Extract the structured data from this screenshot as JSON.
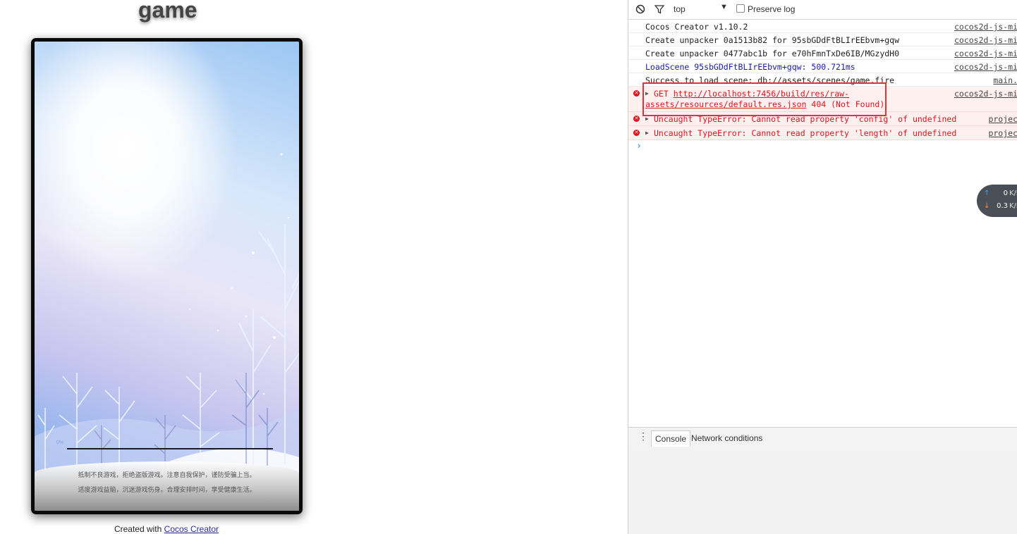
{
  "game": {
    "title": "game",
    "progress_text": "0%",
    "progress": 0,
    "notice_line1": "抵制不良游戏，拒绝盗版游戏。注意自我保护，谨防受骗上当。",
    "notice_line2": "适度游戏益脑，沉迷游戏伤身。合理安排时间，享受健康生活。",
    "created_prefix": "Created with ",
    "created_link": "Cocos Creator"
  },
  "devtools": {
    "context": "top",
    "preserve_log_label": "Preserve log",
    "logs": [
      {
        "type": "log",
        "message": "Cocos Creator v1.10.2",
        "source": "cocos2d-js-mi"
      },
      {
        "type": "log",
        "message": "Create unpacker 0a1513b82 for 95sbGDdFtBLIrEEbvm+gqw",
        "source": "cocos2d-js-mi"
      },
      {
        "type": "log",
        "message": "Create unpacker 0477abc1b for e70hFmnTxDe6IB/MGzydH0",
        "source": "cocos2d-js-mi"
      },
      {
        "type": "info",
        "message": "LoadScene 95sbGDdFtBLIrEEbvm+gqw: 500.721ms",
        "source": "cocos2d-js-mi"
      },
      {
        "type": "log",
        "message": "Success to load scene: db://assets/scenes/game.fire",
        "source": "main."
      }
    ],
    "errors": [
      {
        "method": "GET",
        "url_line1": "http://localhost:7456/build/res/raw-",
        "url_line2": "assets/resources/default.res.json",
        "status": "404 (Not Found)",
        "source": "cocos2d-js-mi"
      },
      {
        "message": "Uncaught TypeError: Cannot read property 'config' of undefined",
        "source": "projec"
      },
      {
        "message": "Uncaught TypeError: Cannot read property 'length' of undefined",
        "source": "projec"
      }
    ],
    "prompt": "›",
    "network": {
      "up_value": "0",
      "up_unit": "K/s",
      "down_value": "0.3",
      "down_unit": "K/s"
    },
    "drawer_tabs": [
      "Console",
      "Network conditions"
    ]
  }
}
